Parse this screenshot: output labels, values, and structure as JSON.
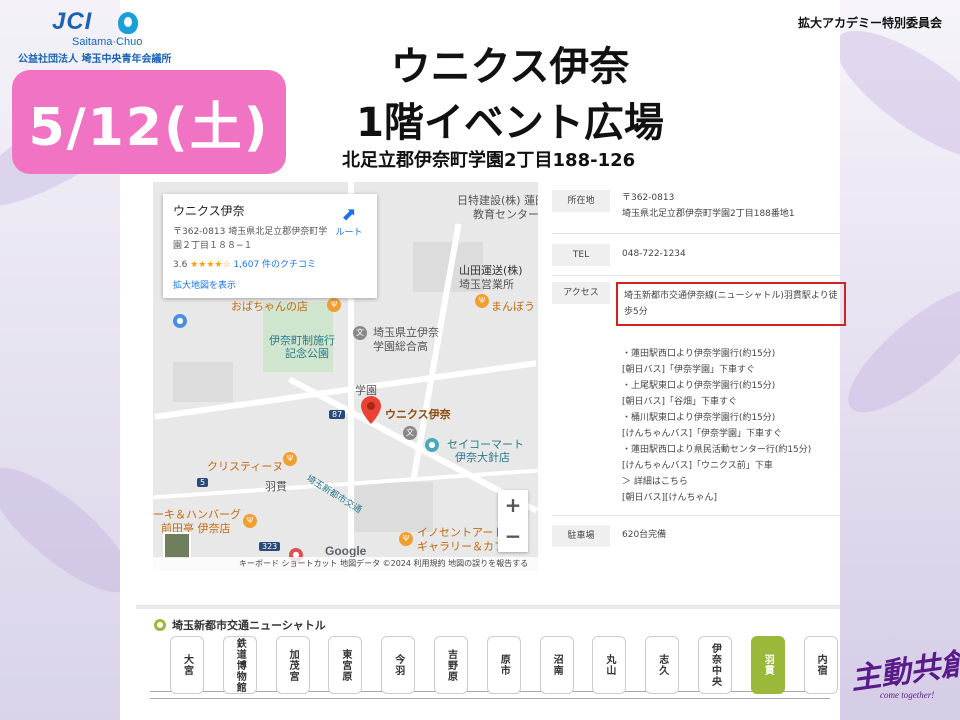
{
  "header": {
    "logo_text": "JCI",
    "logo_sub": "Saitama·Chuo",
    "logo_org": "公益社団法人 埼玉中央青年会議所",
    "top_right": "拡大アカデミー特別委員会"
  },
  "event": {
    "date": "5/12(土)",
    "title_line1": "ウニクス伊奈",
    "title_line2": "1階イベント広場",
    "address": "北足立郡伊奈町学園2丁目188-126"
  },
  "map": {
    "card": {
      "name": "ウニクス伊奈",
      "address": "〒362-0813 埼玉県北足立郡伊奈町学園２丁目１８８−１",
      "rating": "3.6",
      "stars": "★★★★☆",
      "reviews": "1,607 件のクチコミ",
      "larger_map": "拡大地図を表示",
      "route": "ルート"
    },
    "labels": {
      "nikko": "日特建設(株) 蓮田",
      "ed_center": "教育センター",
      "yamada": "山田運送(株)",
      "yamada2": "埼玉営業所",
      "obachan": "おばちゃんの店",
      "manbou": "まんぼう",
      "park1": "伊奈町制施行",
      "park2": "記念公園",
      "school1": "埼玉県立伊奈",
      "school2": "学園総合高",
      "gakuen": "学園",
      "unicus": "ウニクス伊奈",
      "seico1": "セイコーマート",
      "seico2": "伊奈大針店",
      "christie": "クリスティーヌ",
      "hane": "羽貫",
      "line_name": "埼玉新都市交通",
      "steak1": "ーキ＆ハンバーグ",
      "steak2": "前田亭 伊奈店",
      "innocent1": "イノセントアート",
      "innocent2": "ギャラリー＆カフ",
      "rd87": "87",
      "rd5": "5",
      "rd323": "323"
    },
    "google": "Google",
    "footer": "キーボード ショートカット   地図データ ©2024   利用規約   地図の誤りを報告する",
    "zoom_in": "+",
    "zoom_out": "−"
  },
  "info": {
    "address_label": "所在地",
    "address_value": "〒362-0813\n埼玉県北足立郡伊奈町学園2丁目188番地1",
    "tel_label": "TEL",
    "tel_value": "048-722-1234",
    "access_label": "アクセス",
    "access_highlight": "埼玉新都市交通伊奈線(ニューシャトル)羽貫駅より徒歩5分",
    "access_list": [
      "・蓮田駅西口より伊奈学園行(約15分)",
      "[朝日バス]「伊奈学園」下車すぐ",
      "・上尾駅東口より伊奈学園行(約15分)",
      "[朝日バス]「谷畑」下車すぐ",
      "・桶川駅東口より伊奈学園行(約15分)",
      "[けんちゃんバス]「伊奈学園」下車すぐ",
      "・蓮田駅西口より県民活動センター行(約15分)",
      "[けんちゃんバス]「ウニクス前」下車",
      "＞ 詳細はこちら",
      "[朝日バス][けんちゃん]"
    ],
    "parking_label": "駐車場",
    "parking_value": "620台完備"
  },
  "line": {
    "title": "埼玉新都市交通ニューシャトル",
    "stations": [
      "大宮",
      "鉄道博物館",
      "加茂宮",
      "東宮原",
      "今羽",
      "吉野原",
      "原市",
      "沼南",
      "丸山",
      "志久",
      "伊奈中央",
      "羽貫",
      "内宿"
    ],
    "active_index": 11,
    "active_color": "#9ab83a"
  },
  "mascot": {
    "text": "主動共創",
    "sub": "come together!"
  }
}
